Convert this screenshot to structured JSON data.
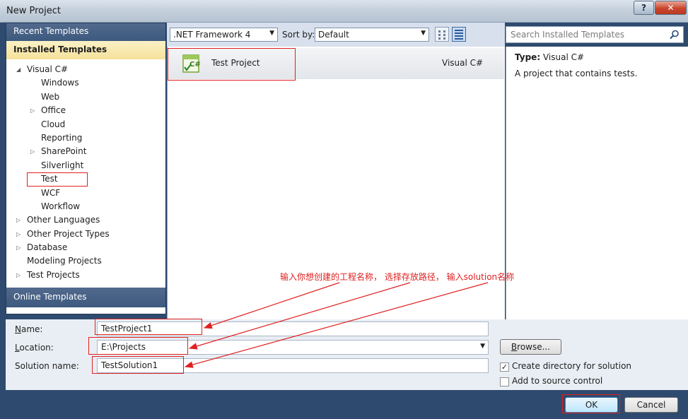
{
  "window": {
    "title": "New Project",
    "help_label": "?",
    "close_label": "✕"
  },
  "leftnav": {
    "recent_label": "Recent Templates",
    "installed_label": "Installed Templates",
    "tree": [
      {
        "label": "Visual C#",
        "level": 0,
        "expander": "expanded"
      },
      {
        "label": "Windows",
        "level": 1,
        "expander": "none"
      },
      {
        "label": "Web",
        "level": 1,
        "expander": "none"
      },
      {
        "label": "Office",
        "level": 1,
        "expander": "collapsed"
      },
      {
        "label": "Cloud",
        "level": 1,
        "expander": "none"
      },
      {
        "label": "Reporting",
        "level": 1,
        "expander": "none"
      },
      {
        "label": "SharePoint",
        "level": 1,
        "expander": "collapsed"
      },
      {
        "label": "Silverlight",
        "level": 1,
        "expander": "none"
      },
      {
        "label": "Test",
        "level": 1,
        "expander": "none"
      },
      {
        "label": "WCF",
        "level": 1,
        "expander": "none"
      },
      {
        "label": "Workflow",
        "level": 1,
        "expander": "none"
      },
      {
        "label": "Other Languages",
        "level": 0,
        "expander": "collapsed"
      },
      {
        "label": "Other Project Types",
        "level": 0,
        "expander": "collapsed"
      },
      {
        "label": "Database",
        "level": 0,
        "expander": "collapsed"
      },
      {
        "label": "Modeling Projects",
        "level": 0,
        "expander": "none"
      },
      {
        "label": "Test Projects",
        "level": 0,
        "expander": "collapsed"
      }
    ],
    "online_label": "Online Templates"
  },
  "toolbar": {
    "framework": ".NET Framework 4",
    "sortby_label": "Sort by:",
    "sortby_value": "Default"
  },
  "search": {
    "placeholder": "Search Installed Templates"
  },
  "templates": [
    {
      "name": "Test Project",
      "language": "Visual C#",
      "icon": "csharp-test-project-icon"
    }
  ],
  "details": {
    "type_label": "Type:",
    "type_value": "Visual C#",
    "description": "A project that contains tests."
  },
  "form": {
    "name_label": "Name:",
    "name_value": "TestProject1",
    "location_label": "Location:",
    "location_value": "E:\\Projects",
    "solution_label": "Solution name:",
    "solution_value": "TestSolution1",
    "browse_label": "Browse...",
    "create_dir_label": "Create directory for solution",
    "create_dir_checked": true,
    "source_control_label": "Add to source control",
    "source_control_checked": false
  },
  "footer": {
    "ok_label": "OK",
    "cancel_label": "Cancel"
  },
  "annotation": {
    "text": "输入你想创建的工程名称， 选择存放路径， 输入solution名称",
    "color": "#e02020"
  }
}
